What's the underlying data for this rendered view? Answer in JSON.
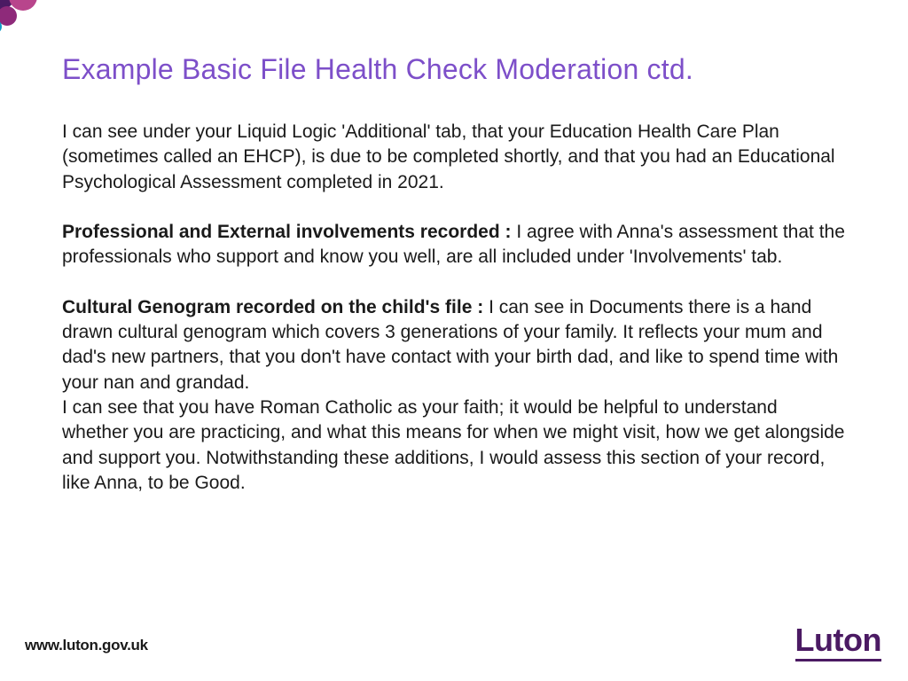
{
  "title": "Example Basic File Health Check Moderation ctd.",
  "p1": "I can see under your Liquid Logic 'Additional' tab, that your Education Health Care Plan (sometimes called an EHCP),  is due to be completed shortly, and that you had an Educational Psychological Assessment completed in 2021.",
  "p2_bold": "Professional and External involvements recorded : ",
  "p2_rest": "I agree with Anna's assessment that the professionals who support and know you well, are all included under 'Involvements' tab.",
  "p3_bold": "Cultural Genogram recorded on the child's file : ",
  "p3_rest": "I can see in Documents there is a hand drawn cultural genogram which covers 3 generations of your family. It reflects your mum and dad's new partners, that you don't have contact with your birth dad, and like to spend time with your nan and grandad.",
  "p3_rest2": "I can see that you have Roman Catholic as your faith; it would be helpful to understand whether you are practicing, and what this means for when we might visit, how we get alongside and support you. Notwithstanding these additions, I would assess this section of your record, like Anna, to be Good.",
  "footer_url": "www.luton.gov.uk",
  "footer_brand": "Luton"
}
